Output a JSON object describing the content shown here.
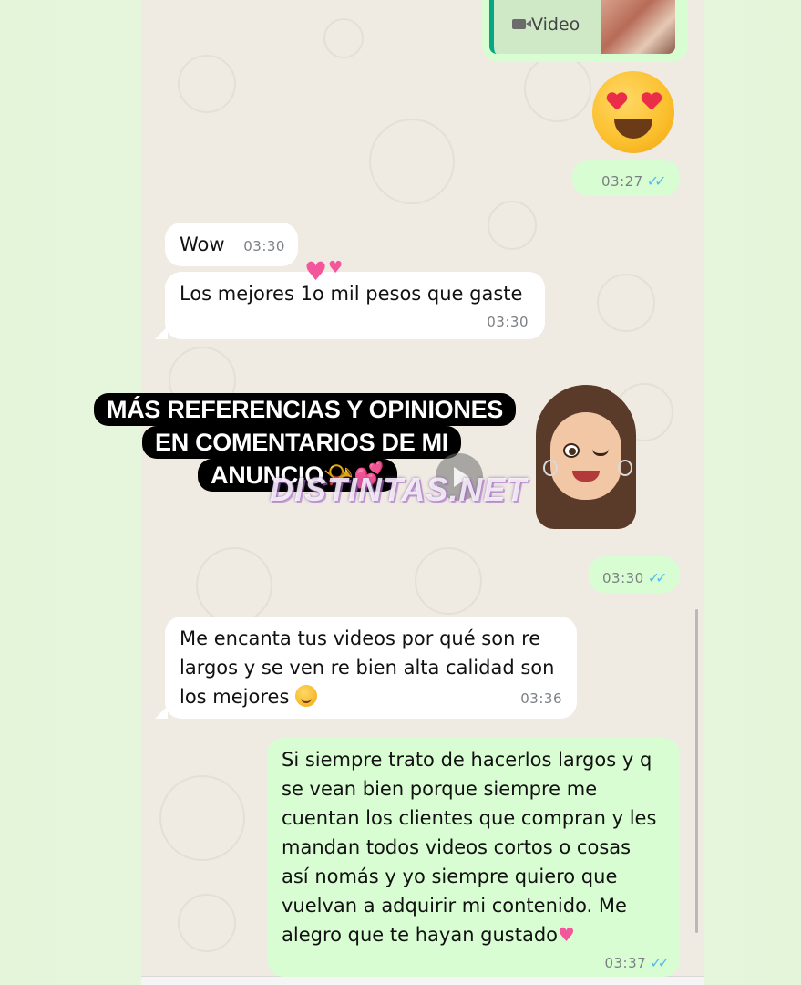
{
  "video_preview": {
    "label": "Video"
  },
  "messages": [
    {
      "id": "m1",
      "direction": "out",
      "text": "",
      "time": "03:27",
      "emoji": "heart-eyes-emoji"
    },
    {
      "id": "m2",
      "direction": "in",
      "text": "Wow",
      "time": "03:30"
    },
    {
      "id": "m3",
      "direction": "in",
      "text": "Los mejores 1o mil pesos que gaste",
      "time": "03:30"
    },
    {
      "id": "m4",
      "direction": "out",
      "text": "",
      "time": "03:30"
    },
    {
      "id": "m5",
      "direction": "in",
      "text": "Me encanta tus videos por qué son re largos y se ven re bien alta calidad son los mejores",
      "time": "03:36"
    },
    {
      "id": "m6",
      "direction": "out",
      "text": "Si siempre trato de hacerlos largos y q se vean bien porque siempre me cuentan los clientes que compran y les mandan todos videos cortos o cosas así nomás y yo siempre quiero que vuelvan a adquirir mi contenido. Me alegro que te hayan gustado",
      "time": "03:37"
    }
  ],
  "lines": {
    "m2": "Wow",
    "m3": "Los mejores 1o mil pesos que gaste",
    "m5": [
      "Me encanta tus videos por qué son re",
      "largos y se ven re bien alta calidad son",
      "los mejores"
    ],
    "m6": [
      "Si siempre trato de hacerlos largos y q",
      "se vean bien porque siempre me",
      "cuentan los clientes que compran y les",
      "mandan todos videos cortos o cosas",
      "así nomás y yo siempre quiero que",
      "vuelvan a adquirir mi contenido. Me",
      "alegro que te hayan gustado"
    ]
  },
  "times": {
    "m1": "03:27",
    "m2": "03:30",
    "m3": "03:30",
    "m4": "03:30",
    "m5": "03:36",
    "m6": "03:37"
  },
  "ticks": "✓✓",
  "overlay": {
    "promo_lines": [
      "MÁS REFERENCIAS Y OPINIONES",
      "EN COMENTARIOS DE MI",
      "ANUNCIO📯💕"
    ],
    "watermark": "DISTINTAS.NET"
  },
  "colors": {
    "incoming_bubble": "#ffffff",
    "outgoing_bubble": "#d9fdd3",
    "chat_background": "#efeae2",
    "read_ticks": "#53bdeb",
    "timestamp": "#7b7f83"
  }
}
